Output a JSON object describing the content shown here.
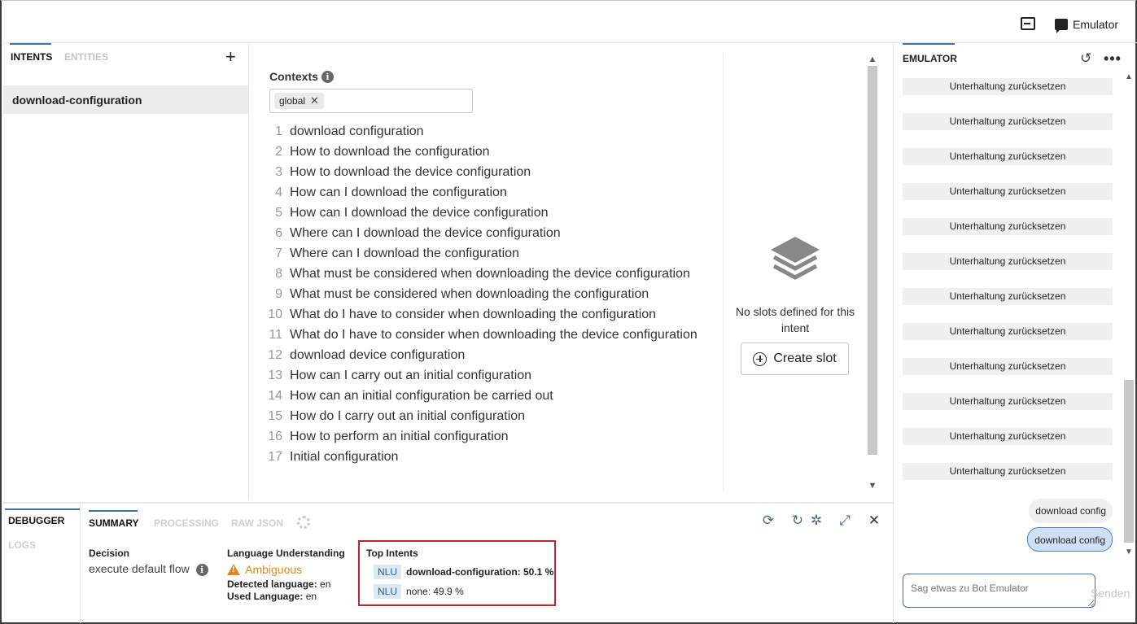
{
  "topbar": {
    "terminal_icon": "terminal-icon",
    "emulator_label": "Emulator"
  },
  "left": {
    "tab_intents": "INTENTS",
    "tab_entities": "ENTITIES",
    "add_label": "+",
    "intents": [
      "download-configuration"
    ]
  },
  "main": {
    "contexts_label": "Contexts",
    "info_glyph": "i",
    "context_tag": "global",
    "context_remove": "✕",
    "utterances": [
      {
        "n": "1",
        "text": "download configuration"
      },
      {
        "n": "2",
        "text": "How to download the configuration"
      },
      {
        "n": "3",
        "text": "How to download the device configuration"
      },
      {
        "n": "4",
        "text": "How can I download the configuration"
      },
      {
        "n": "5",
        "text": "How can I download the device configuration"
      },
      {
        "n": "6",
        "text": "Where can I download the device configuration"
      },
      {
        "n": "7",
        "text": "Where can I download the configuration"
      },
      {
        "n": "8",
        "text": "What must be considered when downloading the device configuration"
      },
      {
        "n": "9",
        "text": "What must be considered when downloading the configuration"
      },
      {
        "n": "10",
        "text": "What do I have to consider when downloading the configuration"
      },
      {
        "n": "11",
        "text": "What do I have to consider when downloading the device configuration"
      },
      {
        "n": "12",
        "text": "download device configuration"
      },
      {
        "n": "13",
        "text": "How can I carry out an initial configuration"
      },
      {
        "n": "14",
        "text": "How can an initial configuration be carried out"
      },
      {
        "n": "15",
        "text": "How do I carry out an initial configuration"
      },
      {
        "n": "16",
        "text": "How to perform an initial configuration"
      },
      {
        "n": "17",
        "text": "Initial configuration"
      }
    ],
    "no_slots_text": "No slots defined for this intent",
    "create_slot_label": "Create slot"
  },
  "debugger": {
    "tab_debugger": "DEBUGGER",
    "tab_logs": "LOGS",
    "tab_summary": "SUMMARY",
    "tab_processing": "PROCESSING",
    "tab_raw_json": "RAW JSON",
    "decision_title": "Decision",
    "decision_value": "execute default flow",
    "lu_title": "Language Understanding",
    "lu_status": "Ambiguous",
    "detected_label": "Detected language:",
    "detected_value": "en",
    "used_label": "Used Language:",
    "used_value": "en",
    "top_intents_title": "Top Intents",
    "nlu_badge": "NLU",
    "top_intent_1": "download-configuration: 50.1 %",
    "top_intent_2": "none: 49.9 %",
    "status_color_warning": "#e08a1e",
    "highlight_color": "#c0262d"
  },
  "emulator": {
    "title": "EMULATOR",
    "reset_label": "Unterhaltung zurücksetzen",
    "bot_message": "download config",
    "user_message": "download config",
    "input_placeholder": "Sag etwas zu Bot Emulator",
    "send_label": "Senden"
  },
  "accent_color": "#3b73b9"
}
